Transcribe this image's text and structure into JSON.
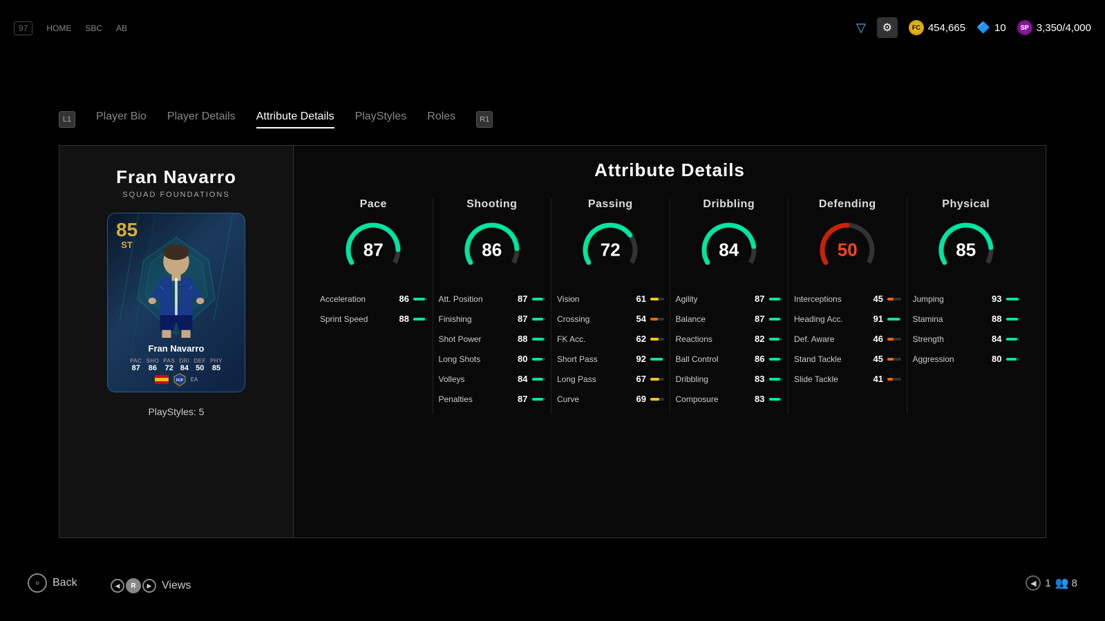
{
  "topbar": {
    "coins": "454,665",
    "shield_count": "10",
    "sp_current": "3,350",
    "sp_max": "4,000"
  },
  "nav": {
    "items": [
      "Player Bio",
      "Player Details",
      "Attribute Details",
      "PlayStyles",
      "Roles"
    ],
    "active_index": 2,
    "left_badge": "L1",
    "right_badge": "R1"
  },
  "player": {
    "name": "Fran Navarro",
    "subtitle": "SQUAD FOUNDATIONS",
    "rating": "85",
    "position": "ST",
    "card_name": "Fran Navarro",
    "stats_labels": [
      "PAC",
      "SHO",
      "PAS",
      "DRI",
      "DEF",
      "PHY"
    ],
    "stats_values": [
      "87",
      "86",
      "72",
      "84",
      "50",
      "85"
    ],
    "playstyles": "PlayStyles: 5"
  },
  "attribute_details": {
    "title": "Attribute Details",
    "columns": [
      {
        "header": "Pace",
        "gauge_value": 87,
        "gauge_color": "green",
        "attributes": [
          {
            "name": "Acceleration",
            "value": 86,
            "color": "green"
          },
          {
            "name": "Sprint Speed",
            "value": 88,
            "color": "green"
          }
        ]
      },
      {
        "header": "Shooting",
        "gauge_value": 86,
        "gauge_color": "green",
        "attributes": [
          {
            "name": "Att. Position",
            "value": 87,
            "color": "green"
          },
          {
            "name": "Finishing",
            "value": 87,
            "color": "green"
          },
          {
            "name": "Shot Power",
            "value": 88,
            "color": "green"
          },
          {
            "name": "Long Shots",
            "value": 80,
            "color": "green"
          },
          {
            "name": "Volleys",
            "value": 84,
            "color": "green"
          },
          {
            "name": "Penalties",
            "value": 87,
            "color": "green"
          }
        ]
      },
      {
        "header": "Passing",
        "gauge_value": 72,
        "gauge_color": "green",
        "attributes": [
          {
            "name": "Vision",
            "value": 61,
            "color": "yellow"
          },
          {
            "name": "Crossing",
            "value": 54,
            "color": "yellow"
          },
          {
            "name": "FK Acc.",
            "value": 62,
            "color": "yellow"
          },
          {
            "name": "Short Pass",
            "value": 92,
            "color": "green"
          },
          {
            "name": "Long Pass",
            "value": 67,
            "color": "yellow"
          },
          {
            "name": "Curve",
            "value": 69,
            "color": "yellow"
          }
        ]
      },
      {
        "header": "Dribbling",
        "gauge_value": 84,
        "gauge_color": "green",
        "attributes": [
          {
            "name": "Agility",
            "value": 87,
            "color": "green"
          },
          {
            "name": "Balance",
            "value": 87,
            "color": "green"
          },
          {
            "name": "Reactions",
            "value": 82,
            "color": "green"
          },
          {
            "name": "Ball Control",
            "value": 86,
            "color": "green"
          },
          {
            "name": "Dribbling",
            "value": 83,
            "color": "green"
          },
          {
            "name": "Composure",
            "value": 83,
            "color": "green"
          }
        ]
      },
      {
        "header": "Defending",
        "gauge_value": 50,
        "gauge_color": "red",
        "attributes": [
          {
            "name": "Interceptions",
            "value": 45,
            "color": "red"
          },
          {
            "name": "Heading Acc.",
            "value": 91,
            "color": "green"
          },
          {
            "name": "Def. Aware",
            "value": 46,
            "color": "red"
          },
          {
            "name": "Stand Tackle",
            "value": 45,
            "color": "red"
          },
          {
            "name": "Slide Tackle",
            "value": 41,
            "color": "red"
          }
        ]
      },
      {
        "header": "Physical",
        "gauge_value": 85,
        "gauge_color": "green",
        "attributes": [
          {
            "name": "Jumping",
            "value": 93,
            "color": "green"
          },
          {
            "name": "Stamina",
            "value": 88,
            "color": "green"
          },
          {
            "name": "Strength",
            "value": 84,
            "color": "green"
          },
          {
            "name": "Aggression",
            "value": 80,
            "color": "green"
          }
        ]
      }
    ]
  },
  "bottom": {
    "back_label": "Back",
    "views_label": "Views",
    "page_num": "1",
    "user_count": "8"
  }
}
